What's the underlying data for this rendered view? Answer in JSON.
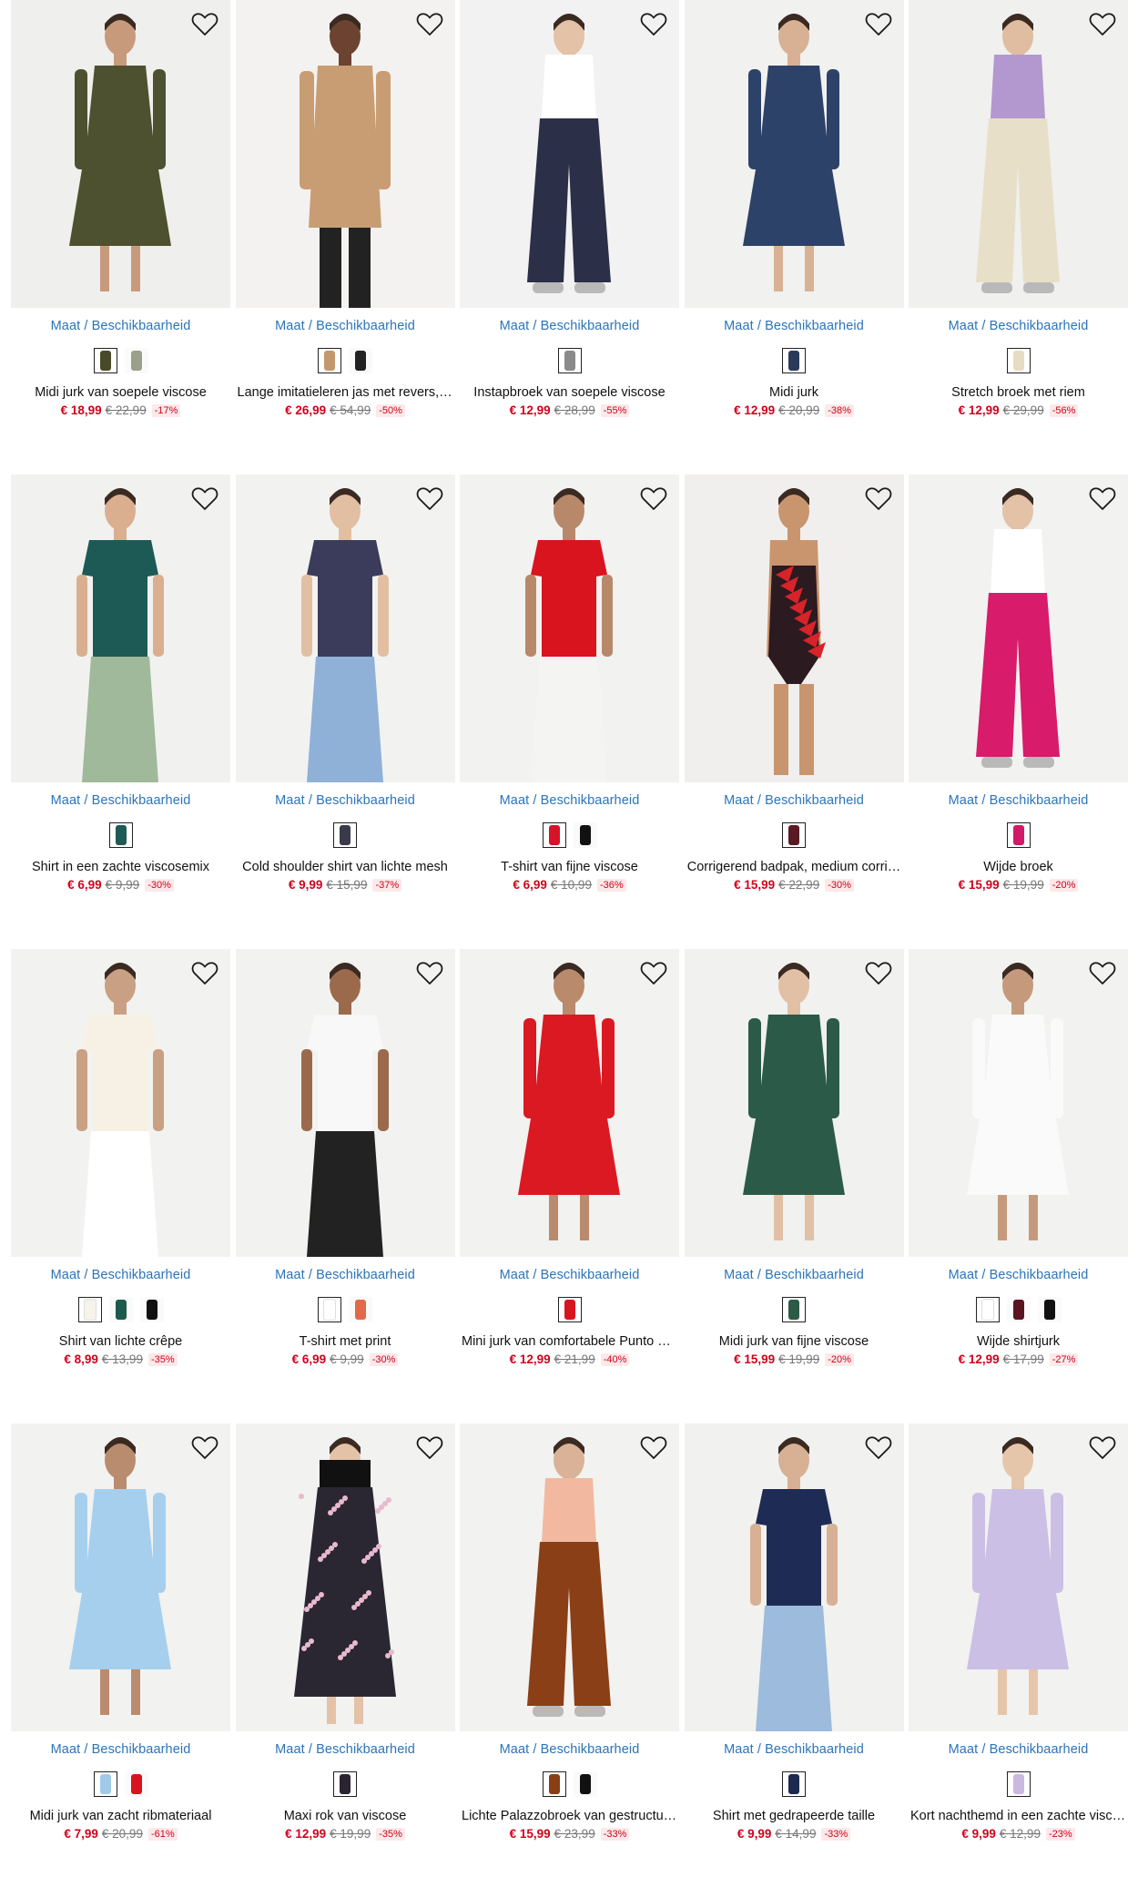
{
  "wishlist_icon": "heart-outline-icon",
  "size_link_label": "Maat / Beschikbaarheid",
  "products": [
    {
      "name": "Midi jurk van soepele viscose",
      "price": "€ 18,99",
      "old_price": "€ 22,99",
      "discount": "-17%",
      "swatches": [
        "#4a4a2a",
        "#9aa08a"
      ],
      "bg": "#efefed",
      "figure": {
        "top": "#4d5130",
        "bottom": "#4d5130",
        "skin": "#c89a7c",
        "style": "dress"
      }
    },
    {
      "name": "Lange imitatieleren jas met revers, …",
      "price": "€ 26,99",
      "old_price": "€ 54,99",
      "discount": "-50%",
      "swatches": [
        "#c4986e",
        "#222222"
      ],
      "bg": "#f3f2f0",
      "figure": {
        "top": "#c99d74",
        "bottom": "#222222",
        "skin": "#6b4330",
        "style": "coat"
      }
    },
    {
      "name": "Instapbroek van soepele viscose",
      "price": "€ 12,99",
      "old_price": "€ 28,99",
      "discount": "-55%",
      "swatches": [
        "#8a8a8a"
      ],
      "bg": "#f2f2f2",
      "figure": {
        "top": "#ffffff",
        "bottom": "#2c2f48",
        "skin": "#e3c2a8",
        "style": "pants"
      }
    },
    {
      "name": "Midi jurk",
      "price": "€ 12,99",
      "old_price": "€ 20,99",
      "discount": "-38%",
      "swatches": [
        "#2c3a5a"
      ],
      "bg": "#f1f1ef",
      "figure": {
        "top": "#2d4268",
        "bottom": "#2d4268",
        "skin": "#d8b194",
        "style": "dress"
      }
    },
    {
      "name": "Stretch broek met riem",
      "price": "€ 12,99",
      "old_price": "€ 29,99",
      "discount": "-56%",
      "swatches": [
        "#e6dcc4"
      ],
      "bg": "#f0f0ee",
      "figure": {
        "top": "#b398cf",
        "bottom": "#e8dfc8",
        "skin": "#e0bda0",
        "style": "pants"
      }
    },
    {
      "name": "Shirt in een zachte viscosemix",
      "price": "€ 6,99",
      "old_price": "€ 9,99",
      "discount": "-30%",
      "swatches": [
        "#1f5a55"
      ],
      "bg": "#f1f1ef",
      "figure": {
        "top": "#1d5a55",
        "bottom": "#9fb99a",
        "skin": "#d9af90",
        "style": "top"
      }
    },
    {
      "name": "Cold shoulder shirt van lichte mesh",
      "price": "€ 9,99",
      "old_price": "€ 15,99",
      "discount": "-37%",
      "swatches": [
        "#3a3a4a"
      ],
      "bg": "#f2f2f0",
      "figure": {
        "top": "#3b3c5c",
        "bottom": "#8fb1d8",
        "skin": "#e2bfa2",
        "style": "top"
      }
    },
    {
      "name": "T-shirt van fijne viscose",
      "price": "€ 6,99",
      "old_price": "€ 10,99",
      "discount": "-36%",
      "swatches": [
        "#d7132a",
        "#111111"
      ],
      "bg": "#f2f2f0",
      "figure": {
        "top": "#d9141f",
        "bottom": "#f4f4f2",
        "skin": "#b8886a",
        "style": "top"
      }
    },
    {
      "name": "Corrigerend badpak, medium corri…",
      "price": "€ 15,99",
      "old_price": "€ 22,99",
      "discount": "-30%",
      "swatches": [
        "#5a1a24"
      ],
      "bg": "#f0efed",
      "figure": {
        "top": "#2b1a1f",
        "bottom": "#c9956f",
        "skin": "#c9956f",
        "style": "swim"
      }
    },
    {
      "name": "Wijde broek",
      "price": "€ 15,99",
      "old_price": "€ 19,99",
      "discount": "-20%",
      "swatches": [
        "#d21a6a"
      ],
      "bg": "#f2f2f0",
      "figure": {
        "top": "#ffffff",
        "bottom": "#d81b6a",
        "skin": "#e3c2a8",
        "style": "pants"
      }
    },
    {
      "name": "Shirt van lichte crêpe",
      "price": "€ 8,99",
      "old_price": "€ 13,99",
      "discount": "-35%",
      "swatches": [
        "#f6f3ea",
        "#1e5a4c",
        "#111111"
      ],
      "bg": "#f2f2f0",
      "figure": {
        "top": "#f6f1e4",
        "bottom": "#ffffff",
        "skin": "#c9a083",
        "style": "top"
      }
    },
    {
      "name": "T-shirt met print",
      "price": "€ 6,99",
      "old_price": "€ 9,99",
      "discount": "-30%",
      "swatches": [
        "#ffffff",
        "#e06a4a"
      ],
      "bg": "#f2f2f0",
      "figure": {
        "top": "#f8f8f8",
        "bottom": "#222222",
        "skin": "#9b6a4c",
        "style": "top"
      }
    },
    {
      "name": "Mini jurk van comfortabele Punto d…",
      "price": "€ 12,99",
      "old_price": "€ 21,99",
      "discount": "-40%",
      "swatches": [
        "#d8141f"
      ],
      "bg": "#f2f2f0",
      "figure": {
        "top": "#db1922",
        "bottom": "#db1922",
        "skin": "#b98a6c",
        "style": "dress"
      }
    },
    {
      "name": "Midi jurk van fijne viscose",
      "price": "€ 15,99",
      "old_price": "€ 19,99",
      "discount": "-20%",
      "swatches": [
        "#2c5a44"
      ],
      "bg": "#f1f1ef",
      "figure": {
        "top": "#2b5b48",
        "bottom": "#2b5b48",
        "skin": "#e1c0a5",
        "style": "dress"
      }
    },
    {
      "name": "Wijde shirtjurk",
      "price": "€ 12,99",
      "old_price": "€ 17,99",
      "discount": "-27%",
      "swatches": [
        "#ffffff",
        "#5a1420",
        "#111111"
      ],
      "bg": "#f2f2f0",
      "figure": {
        "top": "#fafafa",
        "bottom": "#fafafa",
        "skin": "#c59a7c",
        "style": "dress"
      }
    },
    {
      "name": "Midi jurk van zacht ribmateriaal",
      "price": "€ 7,99",
      "old_price": "€ 20,99",
      "discount": "-61%",
      "swatches": [
        "#9fcbe8",
        "#d8141f"
      ],
      "bg": "#f2f2f0",
      "figure": {
        "top": "#a6cfee",
        "bottom": "#a6cfee",
        "skin": "#b98c70",
        "style": "dress"
      }
    },
    {
      "name": "Maxi rok van viscose",
      "price": "€ 12,99",
      "old_price": "€ 19,99",
      "discount": "-35%",
      "swatches": [
        "#2a2430"
      ],
      "bg": "#f2f2f0",
      "figure": {
        "top": "#111111",
        "bottom": "#2a2632",
        "skin": "#e3c2a8",
        "style": "skirt"
      }
    },
    {
      "name": "Lichte Palazzobroek van gestructur…",
      "price": "€ 15,99",
      "old_price": "€ 23,99",
      "discount": "-33%",
      "swatches": [
        "#8a3e14",
        "#111111"
      ],
      "bg": "#f2f2f0",
      "figure": {
        "top": "#f2b9a0",
        "bottom": "#8b3f16",
        "skin": "#d9b297",
        "style": "pants"
      }
    },
    {
      "name": "Shirt met gedrapeerde taille",
      "price": "€ 9,99",
      "old_price": "€ 14,99",
      "discount": "-33%",
      "swatches": [
        "#1c2a50"
      ],
      "bg": "#f1f1ef",
      "figure": {
        "top": "#1e2c55",
        "bottom": "#9dbbdc",
        "skin": "#d8b094",
        "style": "top"
      }
    },
    {
      "name": "Kort nachthemd in een zachte visco…",
      "price": "€ 9,99",
      "old_price": "€ 12,99",
      "discount": "-23%",
      "swatches": [
        "#c9b8e0"
      ],
      "bg": "#f2f2f0",
      "figure": {
        "top": "#cbbfe6",
        "bottom": "#cbbfe6",
        "skin": "#e6c6aa",
        "style": "dress"
      }
    }
  ]
}
